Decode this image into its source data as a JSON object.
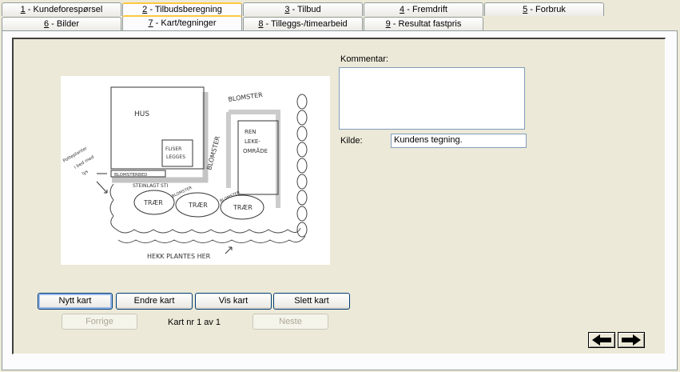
{
  "tabs": {
    "row1": [
      {
        "num": "1",
        "label": " - Kundeforespørsel"
      },
      {
        "num": "2",
        "label": " - Tilbudsberegning"
      },
      {
        "num": "3",
        "label": " - Tilbud"
      },
      {
        "num": "4",
        "label": " - Fremdrift"
      },
      {
        "num": "5",
        "label": " - Forbruk"
      }
    ],
    "row2": [
      {
        "num": "6",
        "label": " - Bilder"
      },
      {
        "num": "7",
        "label": " - Kart/tegninger"
      },
      {
        "num": "8",
        "label": " - Tilleggs-/timearbeid"
      },
      {
        "num": "9",
        "label": " - Resultat fastpris"
      }
    ]
  },
  "form": {
    "comment_label": "Kommentar:",
    "comment_value": "",
    "source_label": "Kilde:",
    "source_value": "Kundens tegning."
  },
  "buttons": {
    "new_map": "Nytt kart",
    "edit_map": "Endre kart",
    "show_map": "Vis kart",
    "delete_map": "Slett kart",
    "previous": "Forrige",
    "next": "Neste"
  },
  "map_counter": "Kart nr 1 av 1",
  "sketch": {
    "hus": "HUS",
    "blomster_top": "BLOMSTER",
    "blomster_side": "BLOMSTER",
    "blomster_bed": "BLOMSTERBED",
    "flisheller": "FLISER",
    "legges": "LEGGES",
    "ren_leke_1": "REN",
    "ren_leke_2": "LEKE-",
    "ren_leke_3": "OMRÅDE",
    "steinlagt": "STEINLAGT STI",
    "tre1": "TRÆR",
    "tre2": "TRÆR",
    "tre3": "TRÆR",
    "blomster_small1": "BLOMSTER",
    "blomster_small2": "BLOMSTER",
    "hekk": "HEKK PLANTES HER",
    "side_note_1": "Potteplanter",
    "side_note_2": "i bed med",
    "side_note_3": "lys"
  }
}
